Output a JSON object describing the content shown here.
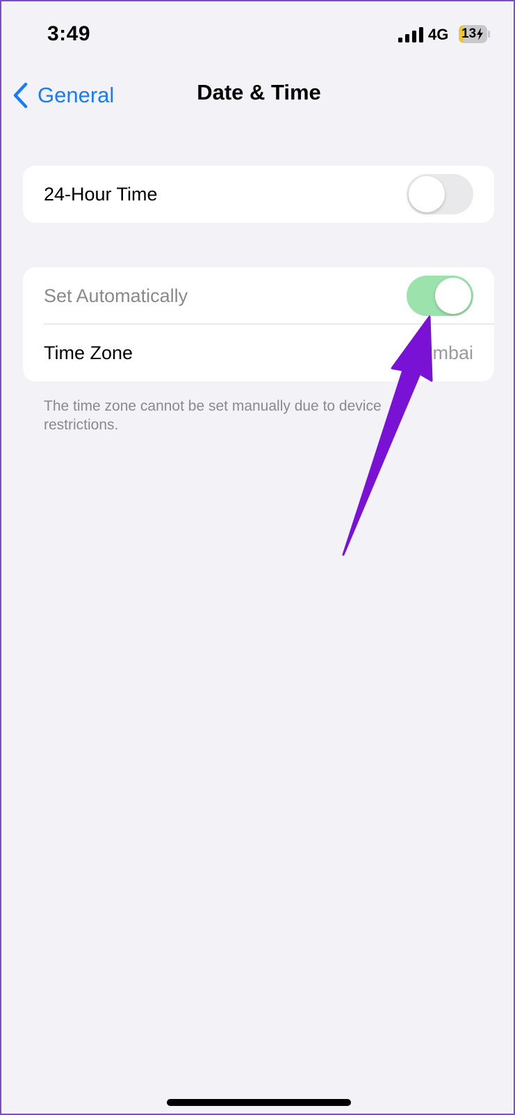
{
  "status_bar": {
    "time": "3:49",
    "network": "4G",
    "battery": "13"
  },
  "nav": {
    "back_label": "General",
    "title": "Date & Time"
  },
  "group1": {
    "row_24h": {
      "label": "24-Hour Time",
      "toggle_on": false
    }
  },
  "group2": {
    "row_auto": {
      "label": "Set Automatically",
      "toggle_on": true
    },
    "row_tz": {
      "label": "Time Zone",
      "value": "Mumbai"
    }
  },
  "footer_note": "The time zone cannot be set manually due to device restrictions.",
  "colors": {
    "accent_blue": "#1a7cf5",
    "toggle_on": "#9be2ac",
    "annotation_arrow": "#7a12d6"
  }
}
